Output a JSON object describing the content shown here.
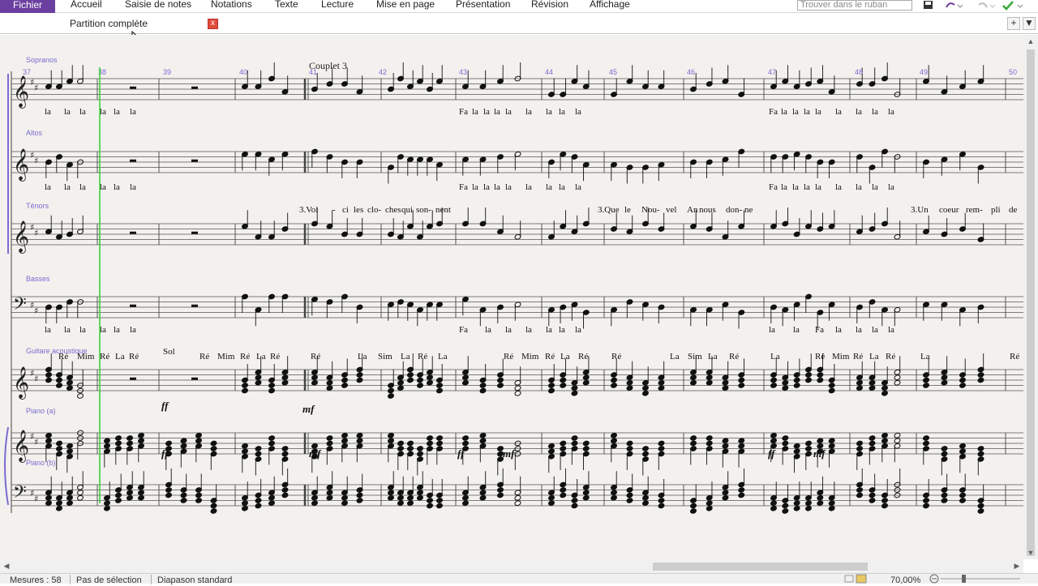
{
  "ribbon": {
    "tabs": [
      "Fichier",
      "Accueil",
      "Saisie de notes",
      "Notations",
      "Texte",
      "Lecture",
      "Mise en page",
      "Présentation",
      "Révision",
      "Affichage"
    ],
    "search_placeholder": "Trouver dans le ruban"
  },
  "doc_tab": {
    "label": "Partition complète",
    "close": "x",
    "add": "+",
    "menu": "▼"
  },
  "score": {
    "section_label": "Couplet 3",
    "measure_numbers": [
      "37",
      "38",
      "39",
      "40",
      "41",
      "42",
      "43",
      "44",
      "45",
      "46",
      "47",
      "48",
      "49",
      "50"
    ],
    "instruments": [
      "Sopranos",
      "Altos",
      "Ténors",
      "Basses",
      "Guitare acoustique",
      "Piano (a)",
      "Piano (b)"
    ],
    "soprano_lyrics": [
      "la",
      "la",
      "la",
      "la",
      "la",
      "la",
      "Fa",
      "la",
      "la",
      "la",
      "la",
      "la",
      "la",
      "la",
      "la",
      "Fa",
      "la",
      "la",
      "la",
      "la",
      "la",
      "la",
      "la",
      "la"
    ],
    "alto_lyrics": [
      "la",
      "la",
      "la",
      "la",
      "la",
      "la",
      "Fa",
      "la",
      "la",
      "la",
      "la",
      "la",
      "la",
      "la",
      "la",
      "Fa",
      "la",
      "la",
      "la",
      "la",
      "la",
      "la",
      "la",
      "la"
    ],
    "tenor_lyrics": [
      "3.Voi",
      "-",
      "ci",
      "les",
      "clo-",
      "ches",
      "qui",
      "son-",
      "nent",
      "3.Que",
      "le",
      "Nou-",
      "vel",
      "An",
      "nous",
      "don-",
      "ne",
      "3.Un",
      "coeur",
      "rem-",
      "pli",
      "de"
    ],
    "bass_lyrics": [
      "la",
      "la",
      "la",
      "la",
      "la",
      "la",
      "Fa",
      "la",
      "la",
      "la",
      "la",
      "la",
      "la",
      "la",
      "la",
      "Fa",
      "la",
      "la",
      "la",
      "la",
      "la",
      "la",
      "la",
      "la"
    ],
    "chords": [
      "Ré",
      "Mim",
      "Ré",
      "La",
      "Ré",
      "Sol",
      "Ré",
      "Mim",
      "Ré",
      "La",
      "Ré",
      "Ré",
      "La",
      "Sim",
      "La",
      "Ré",
      "La",
      "Ré",
      "Mim",
      "Ré",
      "La",
      "Ré",
      "Ré",
      "La",
      "Sim",
      "La",
      "Ré",
      "La",
      "Ré",
      "Mim",
      "Ré",
      "La",
      "Ré",
      "La",
      "Ré"
    ],
    "dynamics": [
      "ff",
      "mf",
      "ff",
      "mf",
      "ff",
      "mf",
      "ff",
      "mf",
      "ff",
      "mf"
    ]
  },
  "status": {
    "measures": "Mesures : 58",
    "selection": "Pas de sélection",
    "pitch": "Diapason standard",
    "zoom": "70,00%"
  }
}
